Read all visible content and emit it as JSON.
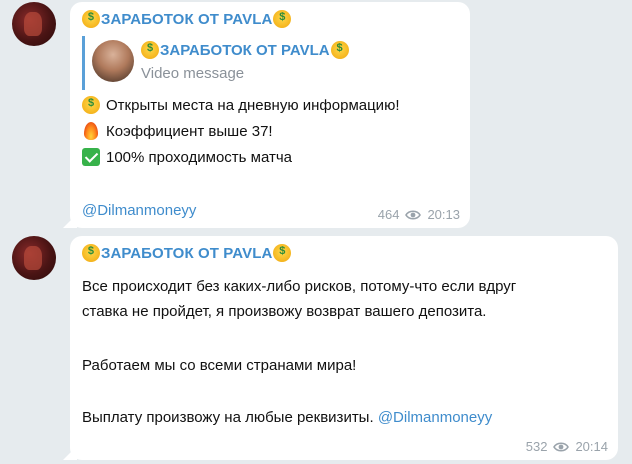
{
  "messages": [
    {
      "sender": "ЗАРАБОТОК ОТ PAVLA",
      "reply": {
        "title": "ЗАРАБОТОК ОТ PAVLA",
        "subtitle": "Video message"
      },
      "lines": [
        "Открыты места на дневную информацию!",
        "Коэффициент выше 37!",
        "100% проходимость матча"
      ],
      "mention": "@Dilmanmoneyy",
      "views": "464",
      "time": "20:13"
    },
    {
      "sender": "ЗАРАБОТОК ОТ PAVLA",
      "paragraph1_line1": "Все происходит без каких-либо рисков, потому-что если вдруг",
      "paragraph1_line2": "ставка не пройдет, я произвожу возврат вашего депозита.",
      "paragraph2": "Работаем мы со всеми странами мира!",
      "paragraph3": "Выплату произвожу на любые реквизиты.",
      "mention": "@Dilmanmoneyy",
      "views": "532",
      "time": "20:14"
    }
  ],
  "colors": {
    "background": "#e6ebee",
    "bubble": "#ffffff",
    "sender": "#3f8ccc",
    "meta": "#9aa3ab"
  },
  "icons": [
    "money-mouth-face-icon",
    "fire-icon",
    "check-mark-button-icon",
    "eye-icon"
  ]
}
